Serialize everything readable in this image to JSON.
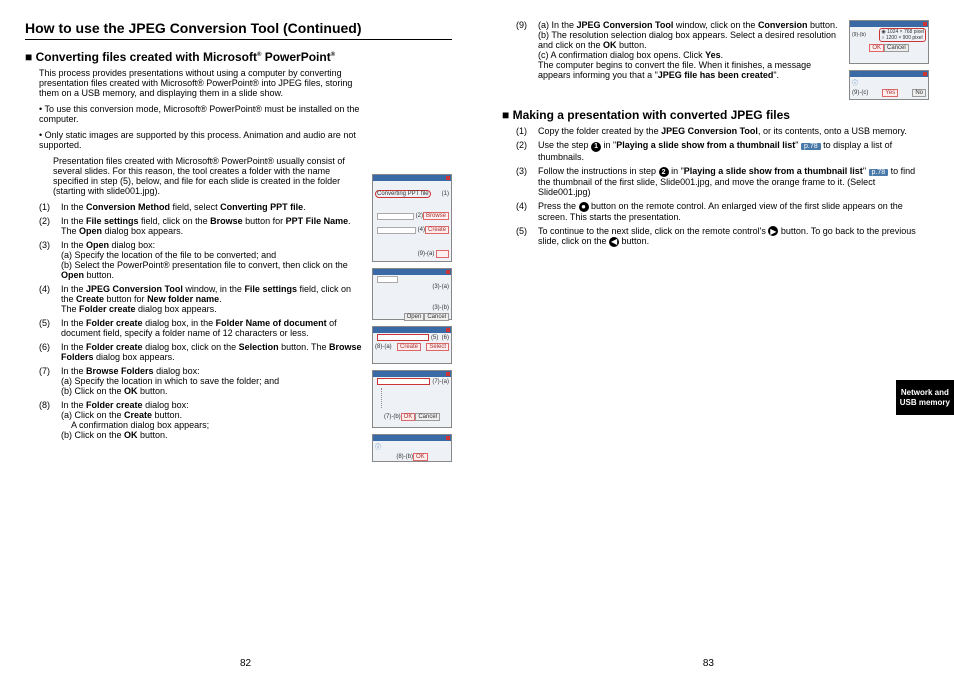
{
  "title": "How to use the JPEG Conversion Tool (Continued)",
  "left": {
    "h2_pre": "■ Converting files created with Microsoft",
    "h2_post": " PowerPoint",
    "intro": "This process provides presentations without using a computer by converting presentation files created with Microsoft® PowerPoint® into JPEG files, storing them on a USB memory, and displaying them in a slide show.",
    "bul1": "To use this conversion mode, Microsoft® PowerPoint® must be installed on the computer.",
    "bul2": "Only static images are supported by this process. Animation and audio are not supported.",
    "note": "Presentation files created with Microsoft® PowerPoint® usually consist of several slides. For this reason, the tool creates a folder with the name specified in step (5), below, and file for each slide is created in the folder (starting with slide001.jpg).",
    "s1a": "In the ",
    "s1b": "Conversion Method",
    "s1c": " field, select ",
    "s1d": "Converting PPT file",
    "s1e": ".",
    "s2a": "In the ",
    "s2b": "File settings",
    "s2c": " field, click on the ",
    "s2d": "Browse",
    "s2e": " button for ",
    "s2f": "PPT File Name",
    "s2g": ".",
    "s2h": "The ",
    "s2i": "Open",
    "s2j": " dialog box appears.",
    "s3a": "In the ",
    "s3b": "Open",
    "s3c": " dialog box:",
    "s3d": "(a) Specify the location of the file to be converted; and",
    "s3e": "(b) Select the PowerPoint® presentation file to convert, then click on the ",
    "s3f": "Open",
    "s3g": " button.",
    "s4a": "In the ",
    "s4b": "JPEG Conversion Tool",
    "s4c": " window, in the ",
    "s4d": "File settings",
    "s4e": " field, click on the ",
    "s4f": "Create",
    "s4g": " button for ",
    "s4h": "New folder name",
    "s4i": ".",
    "s4j": "The ",
    "s4k": "Folder create",
    "s4l": " dialog box appears.",
    "s5a": "In the ",
    "s5b": "Folder create",
    "s5c": " dialog box, in the ",
    "s5d": "Folder Name of document",
    "s5e": " of document field, specify a folder name of 12 characters or less.",
    "s6a": "In the ",
    "s6b": "Folder create",
    "s6c": " dialog box, click on the ",
    "s6d": "Selection",
    "s6e": " button. The ",
    "s6f": "Browse Folders",
    "s6g": " dialog box appears.",
    "s7a": "In the ",
    "s7b": "Browse Folders",
    "s7c": " dialog box:",
    "s7d": "(a) Specify the location in which to save the folder; and",
    "s7e": "(b) Click on the ",
    "s7f": "OK",
    "s7g": " button.",
    "s8a": "In the ",
    "s8b": "Folder create",
    "s8c": " dialog box:",
    "s8d": "(a) Click on the ",
    "s8e": "Create",
    "s8f": " button.",
    "s8g": "A confirmation dialog box appears;",
    "s8h": "(b) Click on the ",
    "s8i": "OK",
    "s8j": " button."
  },
  "right": {
    "s9a": "(a) In the ",
    "s9b": "JPEG Conversion Tool",
    "s9c": " window, click on the ",
    "s9d": "Conversion",
    "s9e": " button.",
    "s9f": "(b) The resolution selection dialog box appears. Select a desired resolution and click on the ",
    "s9g": "OK",
    "s9h": " button.",
    "s9i": "(c) A confirmation dialog box opens. Click ",
    "s9j": "Yes",
    "s9k": ".",
    "s9l": "The computer begins to convert the file. When it finishes, a message appears informing you that a \"",
    "s9m": "JPEG file has been created",
    "s9n": "\".",
    "h2b": "■ Making a presentation with converted JPEG files",
    "m1a": "Copy the folder created by the ",
    "m1b": "JPEG Conversion Tool",
    "m1c": ", or its contents, onto a USB memory.",
    "m2a": "Use the step ",
    "m2b": " in \"",
    "m2c": "Playing a slide show from a thumbnail list",
    "m2d": "\" ",
    "m2e": " to display a list of thumbnails.",
    "m3a": "Follow the instructions in step ",
    "m3b": " in \"",
    "m3c": "Playing a slide show from a thumbnail list",
    "m3d": "\" ",
    "m3e": " to find the thumbnail of the first slide, Slide001.jpg, and move the orange frame to it. (Select Slide001.jpg)",
    "m4a": "Press the ",
    "m4b": " button on the remote control. An enlarged view of the first slide appears on the screen. This starts the presentation.",
    "m5a": "To continue to the next slide, click on the remote control's ",
    "m5b": " button. To go back to the previous slide, click on the ",
    "m5c": " button.",
    "pref": "p.78",
    "res1": "1024 × 768 pixel",
    "res2": "1200 × 900 pixel",
    "ok": "OK",
    "cancel": "Cancel",
    "yes": "Yes",
    "no": "No"
  },
  "tab1": "Network and",
  "tab2": "USB memory",
  "pnum_left": "82",
  "pnum_right": "83"
}
